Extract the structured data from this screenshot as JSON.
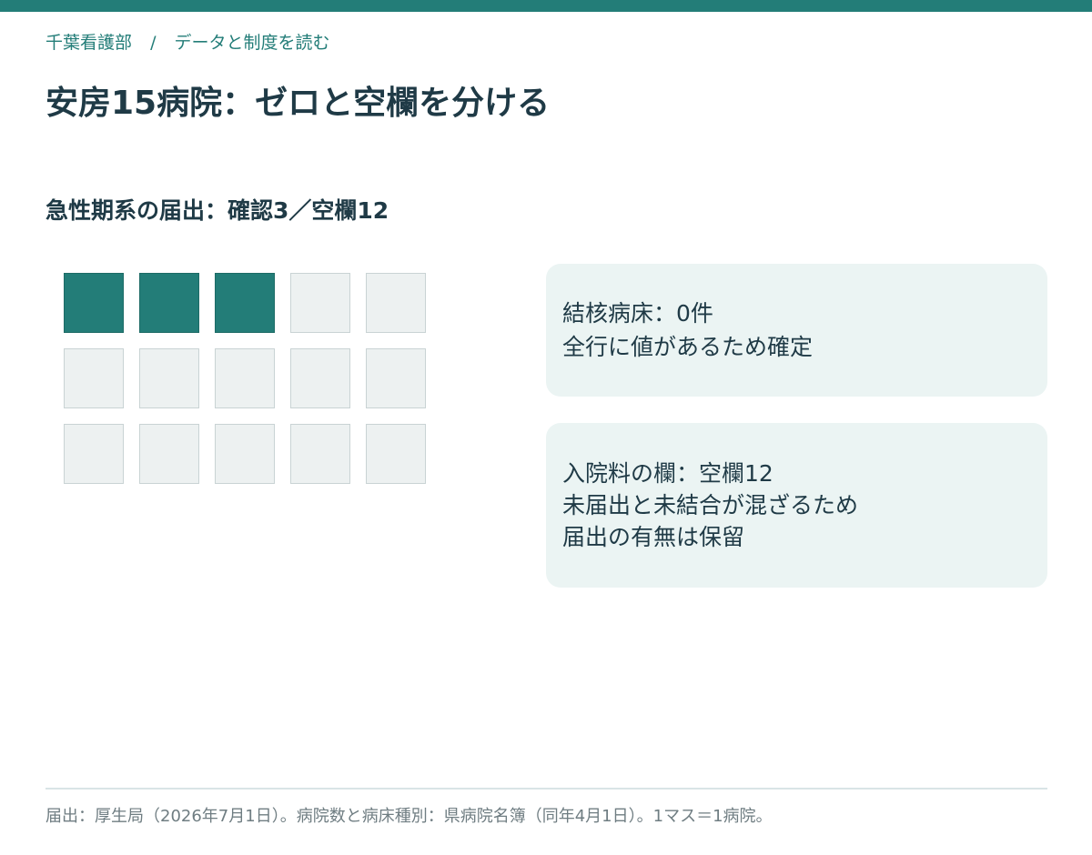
{
  "colors": {
    "accent": "#237d78",
    "text": "#1f3a46",
    "muted": "#6f7d82",
    "cell_empty": "#edf1f1",
    "card_background": "#ebf4f3"
  },
  "breadcrumb": {
    "section": "千葉看護部",
    "separator": "/",
    "category": "データと制度を読む"
  },
  "page_title": "安房15病院：ゼロと空欄を分ける",
  "section_heading": "急性期系の届出：確認3／空欄12",
  "grid": {
    "confirmed": 3,
    "blank": 12,
    "columns": 5
  },
  "cards": [
    {
      "lines": [
        "結核病床：0件",
        "全行に値があるため確定"
      ]
    },
    {
      "lines": [
        "入院料の欄：空欄12",
        "未届出と未結合が混ざるため",
        "届出の有無は保留"
      ]
    }
  ],
  "footer": {
    "note": "届出：厚生局（2026年7月1日）。病院数と病床種別：県病院名簿（同年4月1日）。1マス＝1病院。"
  }
}
